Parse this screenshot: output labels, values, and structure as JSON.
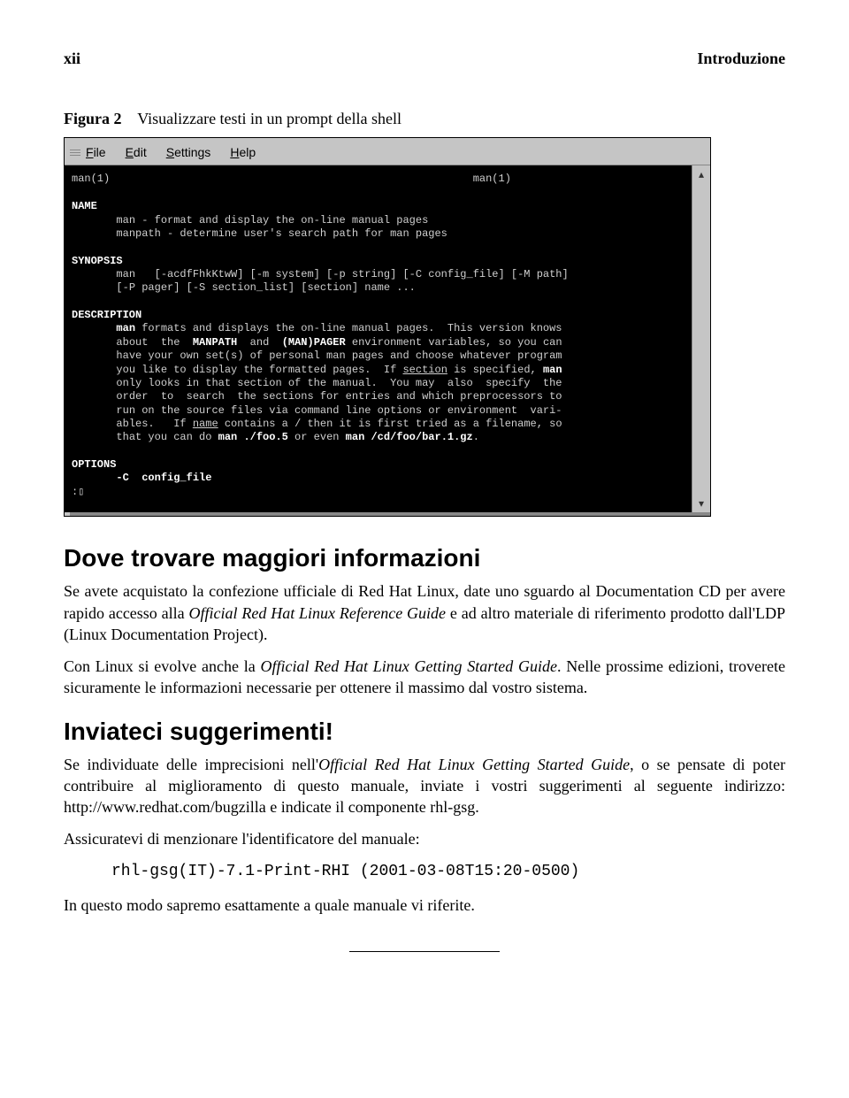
{
  "header": {
    "left": "xii",
    "right": "Introduzione"
  },
  "figure": {
    "label": "Figura 2",
    "caption": "Visualizzare testi in un prompt della shell"
  },
  "terminal": {
    "menu": {
      "file": "File",
      "edit": "Edit",
      "settings": "Settings",
      "help": "Help"
    },
    "head_left": "man(1)",
    "head_right": "man(1)",
    "sec_name": "NAME",
    "name_l1": "man - format and display the on-line manual pages",
    "name_l2": "manpath - determine user's search path for man pages",
    "sec_syn": "SYNOPSIS",
    "syn_l1": "man   [-acdfFhkKtwW] [-m system] [-p string] [-C config_file] [-M path]",
    "syn_l2": "[-P pager] [-S section_list] [section] name ...",
    "sec_desc": "DESCRIPTION",
    "d1a": "man",
    "d1b": " formats and displays the on-line manual pages.  This version knows",
    "d2a": "about  the  ",
    "d2b": "MANPATH",
    "d2c": "  and  ",
    "d2d": "(MAN)PAGER",
    "d2e": " environment variables, so you can",
    "d3": "have your own set(s) of personal man pages and choose whatever program",
    "d4a": "you like to display the formatted pages.  If ",
    "d4b": "section",
    "d4c": " is specified, ",
    "d4d": "man",
    "d5": "only looks in that section of the manual.  You may  also  specify  the",
    "d6": "order  to  search  the sections for entries and which preprocessors to",
    "d7": "run on the source files via command line options or environment  vari-",
    "d8a": "ables.   If ",
    "d8b": "name",
    "d8c": " contains a / then it is first tried as a filename, so",
    "d9a": "that you can do ",
    "d9b": "man ./foo.5",
    "d9c": " or even ",
    "d9d": "man /cd/foo/bar.1.gz",
    "d9e": ".",
    "sec_opts": "OPTIONS",
    "opt_l1": "-C  config_file",
    "prompt": ":",
    "cursor": "▯"
  },
  "s1": {
    "title": "Dove trovare maggiori informazioni",
    "p1a": "Se avete acquistato la confezione ufficiale di Red Hat Linux, date uno sguardo al Documentation CD per avere rapido accesso alla ",
    "p1b": "Official Red Hat Linux Reference Guide",
    "p1c": " e ad altro materiale di riferimento prodotto dall'LDP (Linux Documentation Project).",
    "p2a": "Con Linux si evolve anche la ",
    "p2b": "Official Red Hat Linux Getting Started Guide",
    "p2c": ". Nelle prossime edizioni, troverete sicuramente le informazioni necessarie per ottenere il massimo dal vostro sistema."
  },
  "s2": {
    "title": "Inviateci suggerimenti!",
    "p1a": "Se individuate delle imprecisioni nell'",
    "p1b": "Official Red Hat Linux Getting Started Guide",
    "p1c": ", o se pensate di poter contribuire al miglioramento di questo manuale, inviate i vostri suggerimenti al seguente indirizzo:  http://www.redhat.com/bugzilla e indicate il componente rhl-gsg.",
    "p2": "Assicuratevi di menzionare l'identificatore del manuale:",
    "code": "rhl-gsg(IT)-7.1-Print-RHI (2001-03-08T15:20-0500)",
    "p3": "In questo modo sapremo esattamente a quale manuale vi riferite."
  }
}
